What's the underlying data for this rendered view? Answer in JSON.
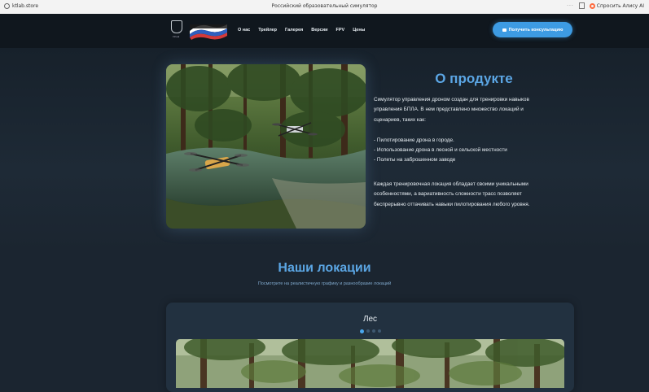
{
  "browser": {
    "url": "ktlab.store",
    "tab_title": "Российский образовательный симулятор",
    "alice_label": "Спросить Алису AI"
  },
  "header": {
    "emblem_text": "Virtual",
    "nav": [
      "О нас",
      "Трейлер",
      "Галерея",
      "Версии",
      "FPV",
      "Цены"
    ],
    "cta_label": "Получить консультацию"
  },
  "about": {
    "title": "О продукте",
    "intro": [
      "Симулятор управления дроном создан для тренировки навыков",
      "управления БПЛА. В нем представлено множество локаций и",
      "сценариев, таких как:"
    ],
    "bullets": [
      "- Пилотирование дрона в городе.",
      "- Использование дрона в лесной и сельской местности",
      "- Полеты на заброшенном заводе"
    ],
    "outro": [
      "Каждая тренировочная локация обладает своими уникальными",
      "особенностями, а вариативность сложности трасс позволяет",
      "беспрерывно оттачивать навыки пилотирования любого уровня."
    ]
  },
  "locations": {
    "title": "Наши локации",
    "subtitle": "Посмотрите на реалистичную графику и разнообразие локаций",
    "current": "Лес",
    "slides_total": 4,
    "active_slide": 1
  },
  "colors": {
    "accent": "#3d9be3",
    "heading": "#5ba6e4",
    "background": "#1b2530",
    "header_bg": "#10171e"
  }
}
